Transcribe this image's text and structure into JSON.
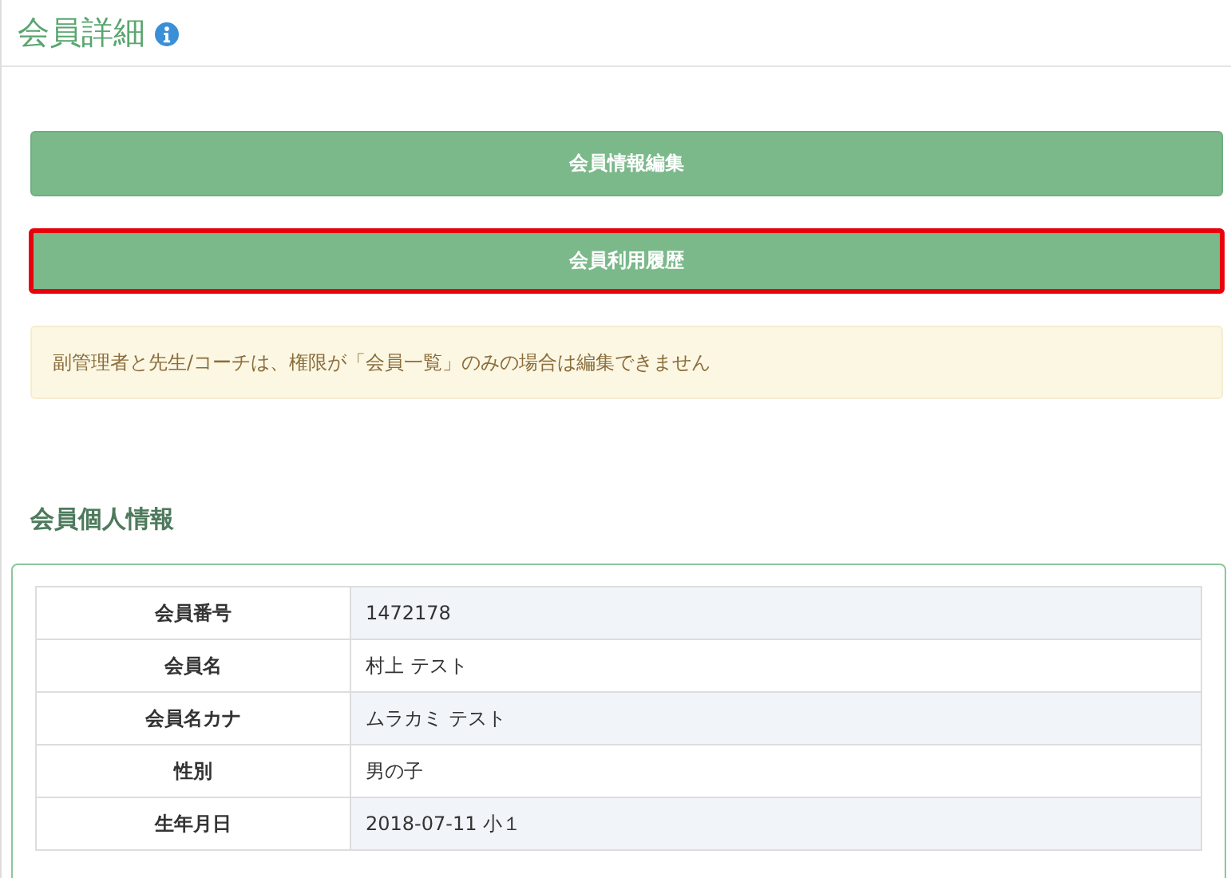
{
  "header": {
    "title": "会員詳細"
  },
  "buttons": [
    {
      "label": "会員情報編集",
      "highlighted": false
    },
    {
      "label": "会員利用履歴",
      "highlighted": true
    }
  ],
  "notice": "副管理者と先生/コーチは、権限が「会員一覧」のみの場合は編集できません",
  "section": {
    "title": "会員個人情報"
  },
  "rows": [
    {
      "label": "会員番号",
      "value": "1472178"
    },
    {
      "label": "会員名",
      "value": "村上 テスト"
    },
    {
      "label": "会員名カナ",
      "value": "ムラカミ テスト"
    },
    {
      "label": "性別",
      "value": "男の子"
    },
    {
      "label": "生年月日",
      "value": "2018-07-11  小１"
    }
  ]
}
